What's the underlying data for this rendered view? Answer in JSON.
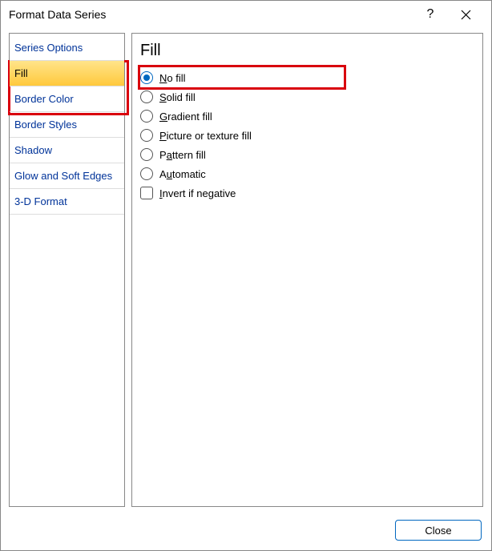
{
  "window": {
    "title": "Format Data Series",
    "help_label": "?",
    "close_label": "×"
  },
  "sidebar": {
    "items": [
      {
        "label": "Series Options",
        "selected": false
      },
      {
        "label": "Fill",
        "selected": true
      },
      {
        "label": "Border Color",
        "selected": false
      },
      {
        "label": "Border Styles",
        "selected": false
      },
      {
        "label": "Shadow",
        "selected": false
      },
      {
        "label": "Glow and Soft Edges",
        "selected": false
      },
      {
        "label": "3-D Format",
        "selected": false
      }
    ]
  },
  "panel": {
    "heading": "Fill",
    "options": [
      {
        "type": "radio",
        "prefix": "",
        "accel": "N",
        "suffix": "o fill",
        "checked": true
      },
      {
        "type": "radio",
        "prefix": "",
        "accel": "S",
        "suffix": "olid fill",
        "checked": false
      },
      {
        "type": "radio",
        "prefix": "",
        "accel": "G",
        "suffix": "radient fill",
        "checked": false
      },
      {
        "type": "radio",
        "prefix": "",
        "accel": "P",
        "suffix": "icture or texture fill",
        "checked": false
      },
      {
        "type": "radio",
        "prefix": "P",
        "accel": "a",
        "suffix": "ttern fill",
        "checked": false
      },
      {
        "type": "radio",
        "prefix": "A",
        "accel": "u",
        "suffix": "tomatic",
        "checked": false
      },
      {
        "type": "checkbox",
        "prefix": "",
        "accel": "I",
        "suffix": "nvert if negative",
        "checked": false
      }
    ]
  },
  "footer": {
    "close_label": "Close"
  }
}
